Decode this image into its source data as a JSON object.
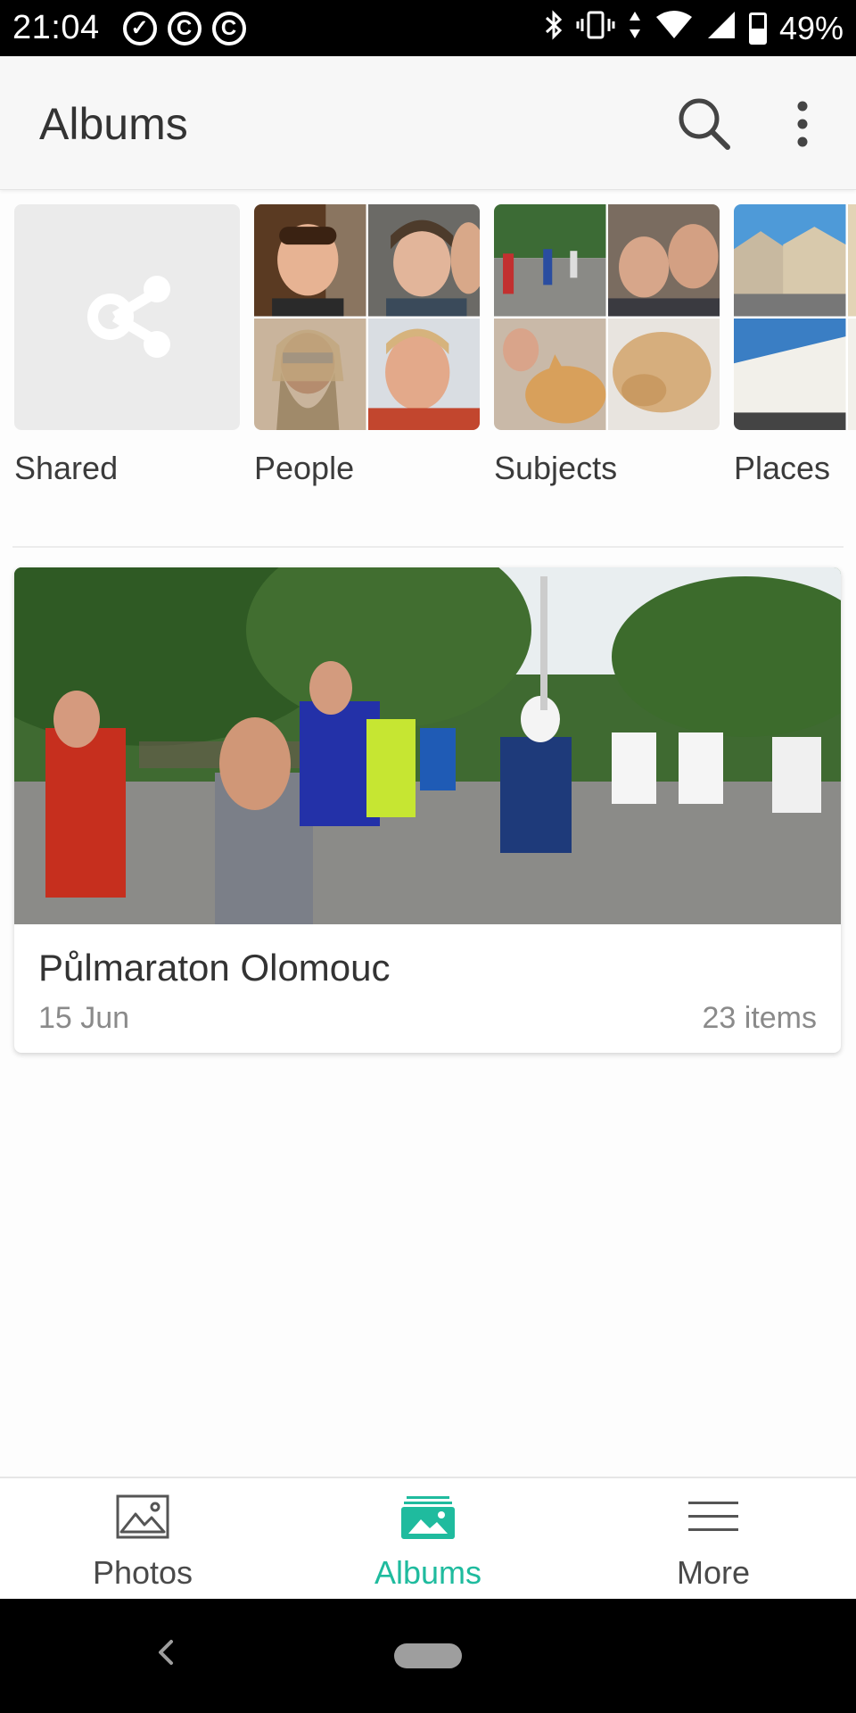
{
  "status_bar": {
    "time": "21:04",
    "left_icons": [
      "check-circle-icon",
      "notification-c-icon",
      "notification-c-icon"
    ],
    "right_icons": [
      "bluetooth-icon",
      "vibrate-icon",
      "data-arrows-icon",
      "wifi-icon",
      "cell-signal-icon",
      "battery-icon"
    ],
    "battery": "49%"
  },
  "app_bar": {
    "title": "Albums"
  },
  "categories": [
    {
      "label": "Shared",
      "icon": "share-icon"
    },
    {
      "label": "People"
    },
    {
      "label": "Subjects"
    },
    {
      "label": "Places"
    }
  ],
  "albums": [
    {
      "title": "Půlmaraton Olomouc",
      "date": "15 Jun",
      "count": "23 items"
    }
  ],
  "bottom_nav": {
    "items": [
      {
        "label": "Photos",
        "icon": "photo-icon",
        "active": false
      },
      {
        "label": "Albums",
        "icon": "albums-icon",
        "active": true
      },
      {
        "label": "More",
        "icon": "hamburger-menu-icon",
        "active": false
      }
    ],
    "accent": "#1fbb9e"
  }
}
